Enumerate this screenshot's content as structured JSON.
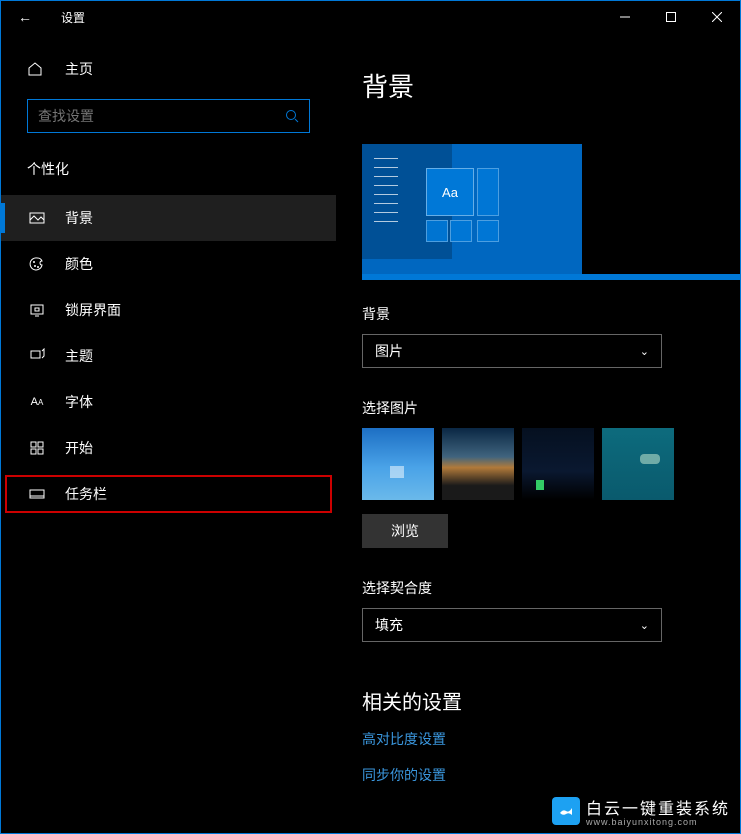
{
  "titlebar": {
    "title": "设置"
  },
  "sidebar": {
    "home": "主页",
    "search_placeholder": "查找设置",
    "section": "个性化",
    "items": [
      {
        "label": "背景",
        "icon": "image-icon",
        "active": true
      },
      {
        "label": "颜色",
        "icon": "palette-icon"
      },
      {
        "label": "锁屏界面",
        "icon": "lockscreen-icon"
      },
      {
        "label": "主题",
        "icon": "brush-icon"
      },
      {
        "label": "字体",
        "icon": "font-icon"
      },
      {
        "label": "开始",
        "icon": "start-icon"
      },
      {
        "label": "任务栏",
        "icon": "taskbar-icon",
        "highlight": true
      }
    ]
  },
  "main": {
    "title": "背景",
    "preview_tile_text": "Aa",
    "bg_label": "背景",
    "bg_dropdown": "图片",
    "choose_label": "选择图片",
    "browse": "浏览",
    "fit_label": "选择契合度",
    "fit_dropdown": "填充",
    "related_title": "相关的设置",
    "links": [
      "高对比度设置",
      "同步你的设置"
    ]
  },
  "watermark": {
    "text": "白云一键重装系统",
    "url": "www.baiyunxitong.com"
  }
}
